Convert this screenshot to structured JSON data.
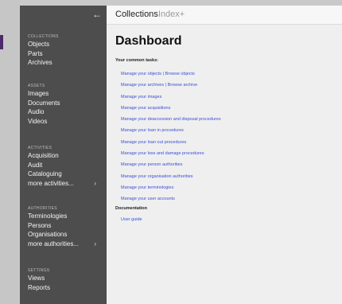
{
  "app": {
    "brand_main": "Collections",
    "brand_light": "Index+"
  },
  "sidebar": {
    "back_icon": "←",
    "sections": [
      {
        "title": "COLLECTIONS",
        "items": [
          {
            "label": "Objects"
          },
          {
            "label": "Parts"
          },
          {
            "label": "Archives"
          }
        ]
      },
      {
        "title": "ASSETS",
        "items": [
          {
            "label": "Images"
          },
          {
            "label": "Documents"
          },
          {
            "label": "Audio"
          },
          {
            "label": "Videos"
          }
        ]
      },
      {
        "title": "ACTIVITIES",
        "items": [
          {
            "label": "Acquisition"
          },
          {
            "label": "Audit"
          },
          {
            "label": "Cataloguing"
          },
          {
            "label": "more activities...",
            "chevron": "›"
          }
        ]
      },
      {
        "title": "AUTHORITIES",
        "items": [
          {
            "label": "Terminologies"
          },
          {
            "label": "Persons"
          },
          {
            "label": "Organisations"
          },
          {
            "label": "more authorities...",
            "chevron": "›"
          }
        ]
      },
      {
        "title": "SETTINGS",
        "items": [
          {
            "label": "Views"
          },
          {
            "label": "Reports"
          }
        ]
      }
    ]
  },
  "main": {
    "title": "Dashboard",
    "tasks_heading": "Your common tasks:",
    "tasks": [
      "Manage your objects | Browse objects",
      "Manage your archives | Browse archive",
      "Manage your images",
      "Manage your acquisitions",
      "Manage your deaccession and disposal procedures",
      "Manage your loan in procedures",
      "Manage your loan out procedures",
      "Manage your loss and damage procedures",
      "Manage your person authorities",
      "Manage your organisation authorities",
      "Manage your terminologies",
      "Manage your user accounts"
    ],
    "documentation_heading": "Documentation",
    "documentation_link": "User guide"
  }
}
